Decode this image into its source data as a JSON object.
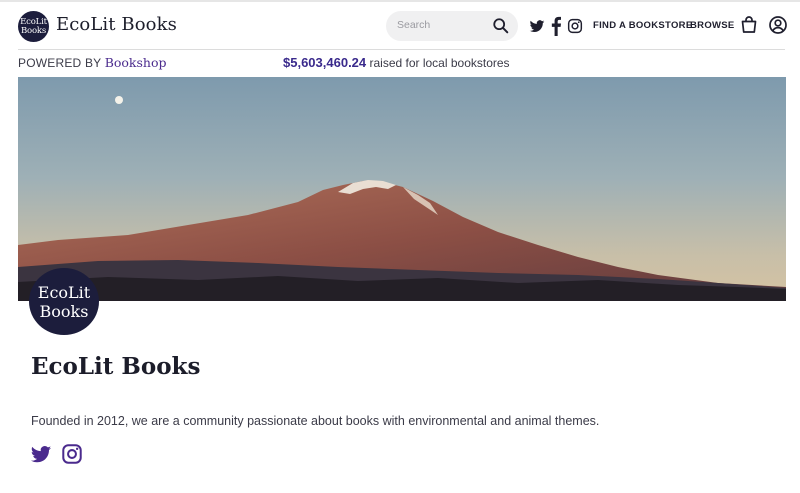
{
  "header": {
    "logo_line1": "EcoLit",
    "logo_line2": "Books",
    "site_name": "EcoLit Books",
    "search_placeholder": "Search",
    "nav": [
      "FIND A BOOKSTORE",
      "BROWSE"
    ],
    "icons": [
      "twitter-icon",
      "facebook-icon",
      "instagram-icon",
      "search-icon",
      "bag-icon",
      "account-icon"
    ]
  },
  "subbar": {
    "powered_prefix": "POWERED BY",
    "powered_brand": "Bookshop",
    "raised_amount": "$5,603,460.24",
    "raised_suffix": "raised for local bookstores"
  },
  "profile": {
    "badge_line1": "EcoLit",
    "badge_line2": "Books",
    "title": "EcoLit Books",
    "description": "Founded in 2012, we are a community passionate about books with environmental and animal themes.",
    "social_icons": [
      "twitter-icon",
      "instagram-icon"
    ]
  },
  "colors": {
    "accent": "#4a2a8d",
    "badge": "#1c1d3c"
  }
}
